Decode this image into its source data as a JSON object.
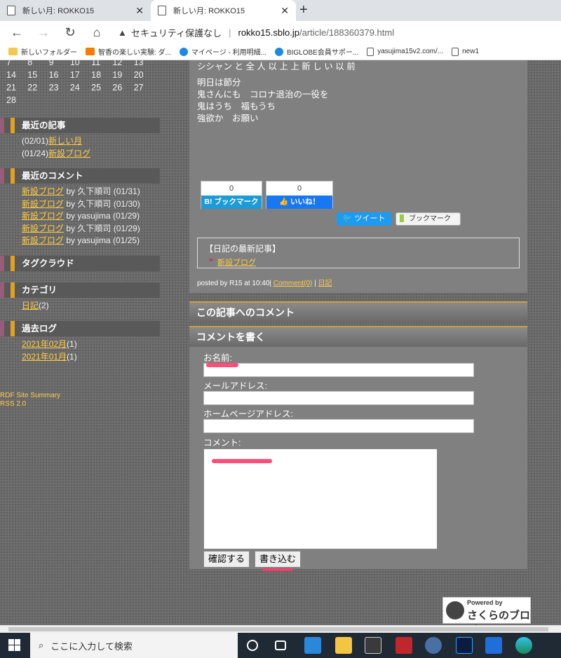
{
  "browser": {
    "tabs": [
      {
        "title": "新しい月: ROKKO15"
      },
      {
        "title": "新しい月: ROKKO15"
      }
    ],
    "address": {
      "security": "セキュリティ保護なし",
      "host": "rokko15.sblo.jp",
      "path": "/article/188360379.html"
    },
    "bookmarks": [
      {
        "label": "新しいフォルダー",
        "icon": "folder-icon"
      },
      {
        "label": "智香の楽しい実験: ダ...",
        "icon": "blogger-icon"
      },
      {
        "label": "マイページ - 利用明細...",
        "icon": "globe-icon"
      },
      {
        "label": "BIGLOBE会員サポー...",
        "icon": "globe-icon"
      },
      {
        "label": "yasujima15v2.com/...",
        "icon": "page-icon"
      },
      {
        "label": "new1",
        "icon": "page-icon"
      }
    ]
  },
  "calendar": {
    "rows": [
      [
        "7",
        "8",
        "9",
        "10",
        "11",
        "12",
        "13"
      ],
      [
        "14",
        "15",
        "16",
        "17",
        "18",
        "19",
        "20"
      ],
      [
        "21",
        "22",
        "23",
        "24",
        "25",
        "26",
        "27"
      ],
      [
        "28"
      ]
    ]
  },
  "sidebar": {
    "recent_articles": {
      "title": "最近の記事",
      "items": [
        {
          "date": "(02/01)",
          "link": "新しい月"
        },
        {
          "date": "(01/24)",
          "link": "新設ブログ"
        }
      ]
    },
    "recent_comments": {
      "title": "最近のコメント",
      "items": [
        {
          "link": "新設ブログ",
          "text": " by 久下順司 (01/31)"
        },
        {
          "link": "新設ブログ",
          "text": " by 久下順司 (01/30)"
        },
        {
          "link": "新設ブログ",
          "text": " by yasujima (01/29)"
        },
        {
          "link": "新設ブログ",
          "text": " by 久下順司 (01/29)"
        },
        {
          "link": "新設ブログ",
          "text": " by yasujima (01/25)"
        }
      ]
    },
    "tag_cloud": {
      "title": "タグクラウド"
    },
    "categories": {
      "title": "カテゴリ",
      "items": [
        {
          "link": "日記",
          "count": "(2)"
        }
      ]
    },
    "archives": {
      "title": "過去ログ",
      "items": [
        {
          "link": "2021年02月",
          "count": "(1)"
        },
        {
          "link": "2021年01月",
          "count": "(1)"
        }
      ]
    },
    "rdf": {
      "line1": "RDF Site Summary",
      "line2": "RSS 2.0"
    }
  },
  "article": {
    "cut_line": "シシャン と 全 人 以 上 上 新 し い 以 前",
    "lines": [
      "明日は節分",
      "鬼さんにも　コロナ退治の一役を",
      "鬼はうち　福もうち",
      "強欲か　お願い"
    ],
    "hatena": {
      "count": "0",
      "label": "B! ブックマーク"
    },
    "like": {
      "count": "0",
      "label": "いいね！"
    },
    "tweet_label": "ツイート",
    "pocket_label": "ブックマーク",
    "latest": {
      "title": "【日記の最新記事】",
      "link": "新設ブログ"
    },
    "posted": {
      "prefix": "posted by R15 at 10:40| ",
      "comment": "Comment(0)",
      "sep": " | ",
      "category": "日記"
    }
  },
  "comments": {
    "title": "この記事へのコメント"
  },
  "form": {
    "title": "コメントを書く",
    "name_label": "お名前:",
    "email_label": "メールアドレス:",
    "homepage_label": "ホームページアドレス:",
    "comment_label": "コメント:",
    "confirm_button": "確認する",
    "submit_button": "書き込む"
  },
  "sakura": {
    "top": "Powered by",
    "main": "さくらのブログ"
  },
  "taskbar": {
    "search_placeholder": "ここに入力して検索"
  }
}
